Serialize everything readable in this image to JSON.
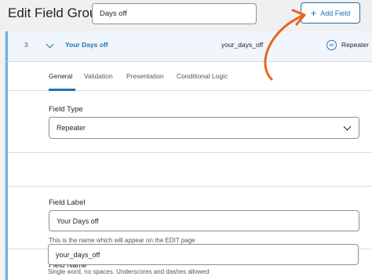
{
  "header": {
    "title": "Edit Field Group",
    "group_name_value": "Days off",
    "add_field_label": "Add Field"
  },
  "field_row": {
    "order": "3",
    "label": "Your Days off",
    "name": "your_days_off",
    "type": "Repeater",
    "type_icon": "infinity-icon"
  },
  "tabs": [
    {
      "label": "General",
      "active": true
    },
    {
      "label": "Validation",
      "active": false
    },
    {
      "label": "Presentation",
      "active": false
    },
    {
      "label": "Conditional Logic",
      "active": false
    }
  ],
  "settings": {
    "field_type": {
      "label": "Field Type",
      "value": "Repeater"
    },
    "field_label": {
      "label": "Field Label",
      "value": "Your Days off",
      "hint": "This is the name which will appear on the EDIT page"
    },
    "field_name": {
      "label": "Field Name",
      "value": "your_days_off",
      "hint": "Single word, no spaces. Underscores and dashes allowed"
    }
  },
  "colors": {
    "accent": "#2271b1",
    "annotation_arrow": "#e8651e",
    "row_highlight": "#f0f6fc"
  }
}
